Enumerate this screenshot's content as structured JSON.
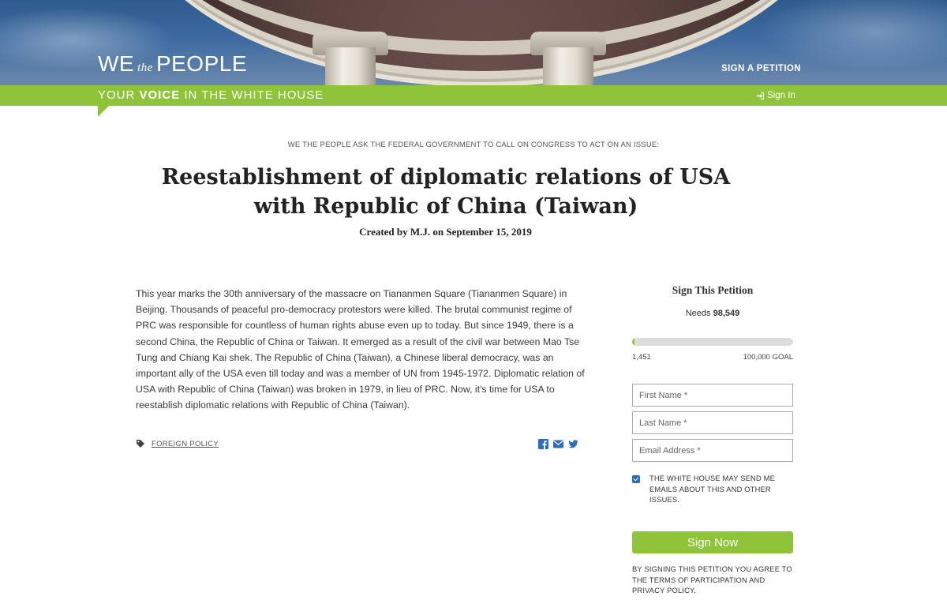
{
  "header": {
    "logo": {
      "we": "WE",
      "the": "the",
      "people": "PEOPLE"
    },
    "sign_petition_link": "SIGN A PETITION",
    "tagline": {
      "pre": "YOUR ",
      "bold": "VOICE",
      "post": " IN THE WHITE HOUSE"
    },
    "sign_in": "Sign In"
  },
  "petition": {
    "ask_line": "WE THE PEOPLE ASK THE FEDERAL GOVERNMENT TO CALL ON CONGRESS TO ACT ON AN ISSUE:",
    "title_line1": "Reestablishment of diplomatic relations of USA",
    "title_line2": "with Republic of China (Taiwan)",
    "created": "Created by M.J. on September 15, 2019",
    "body": "This year marks the 30th anniversary of the massacre on Tiananmen Square (Tiananmen Square) in Beijing. Thousands of peaceful pro-democracy protestors were killed. The brutal communist regime of PRC was responsible for countless of human rights abuse even up to today. But since 1949, there is a second China, the Republic of China or Taiwan. It emerged as a result of the civil war between Mao Tse Tung and Chiang Kai shek. The Republic of China (Taiwan), a Chinese liberal democracy, was an important ally of the USA even till today and was a member of UN from 1945-1972. Diplomatic relation of USA with Republic of China (Taiwan) was broken in 1979, in lieu of PRC. Now, it's time for USA to reestablish diplomatic relations with Republic of China (Taiwan).",
    "tag": "FOREIGN POLICY",
    "share_icons": [
      "facebook-icon",
      "email-icon",
      "twitter-icon"
    ]
  },
  "sidebar": {
    "heading": "Sign This Petition",
    "needs_label": "Needs ",
    "needs_value": "98,549",
    "signatures": "1,451",
    "goal": "100,000 GOAL",
    "progress_fraction": 0.01451,
    "first_name_placeholder": "First Name *",
    "last_name_placeholder": "Last Name *",
    "email_placeholder": "Email Address *",
    "optin_checked": true,
    "optin_text": "THE WHITE HOUSE MAY SEND ME EMAILS ABOUT THIS AND OTHER ISSUES.",
    "sign_button": "Sign Now",
    "terms": "BY SIGNING THIS PETITION YOU AGREE TO THE TERMS OF PARTICIPATION AND PRIVACY POLICY."
  },
  "colors": {
    "accent_green": "#8fc33a",
    "share_blue": "#2a6ebb"
  }
}
